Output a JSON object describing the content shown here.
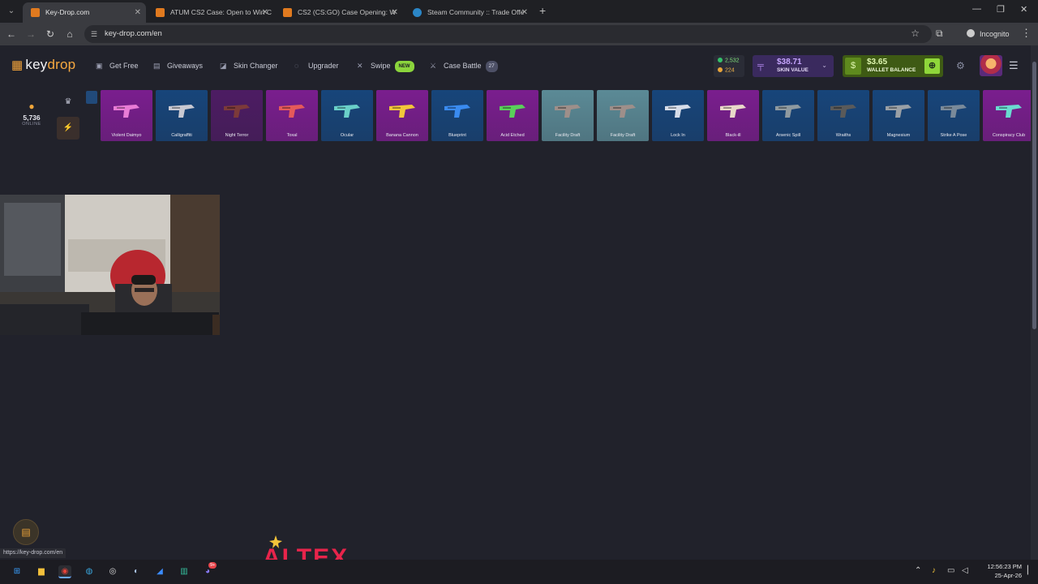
{
  "browser": {
    "tabs": [
      {
        "title": "Key-Drop.com",
        "active": true,
        "favicon": "key-drop-favicon"
      },
      {
        "title": "ATUM CS2 Case: Open to Win C",
        "active": false,
        "favicon": "key-drop-favicon"
      },
      {
        "title": "CS2 (CS:GO) Case Opening: W",
        "active": false,
        "favicon": "key-drop-favicon"
      },
      {
        "title": "Steam Community :: Trade Offe",
        "active": false,
        "favicon": "steam-favicon"
      }
    ],
    "url": "key-drop.com/en",
    "profile_label": "Incognito",
    "status_url": "https://key-drop.com/en"
  },
  "site": {
    "logo": {
      "key": "key",
      "drop": "drop"
    },
    "nav": [
      {
        "label": "Get Free",
        "icon": "gift-icon"
      },
      {
        "label": "Giveaways",
        "icon": "giveaway-icon"
      },
      {
        "label": "Skin Changer",
        "icon": "skin-changer-icon"
      },
      {
        "label": "Upgrader",
        "icon": "upgrader-icon"
      },
      {
        "label": "Swipe",
        "icon": "swipe-icon",
        "badge": "NEW"
      },
      {
        "label": "Case Battle",
        "icon": "swords-icon",
        "badge": "27"
      }
    ],
    "currency": {
      "gems": "2,532",
      "coins": "224"
    },
    "skin_value": {
      "amount": "$38.71",
      "label": "SKIN VALUE"
    },
    "wallet": {
      "amount": "$3.65",
      "label": "WALLET BALANCE"
    },
    "online": {
      "count": "5,736",
      "label": "ONLINE"
    }
  },
  "drops": [
    {
      "name": "Violent Daimyo",
      "bg": "#7a1e8e"
    },
    {
      "name": "Calligraffiti",
      "bg": "#17457a"
    },
    {
      "name": "Night Terror",
      "bg": "#4d1c63"
    },
    {
      "name": "Toxal",
      "bg": "#7a1e8e"
    },
    {
      "name": "Ocular",
      "bg": "#17457a"
    },
    {
      "name": "Banana Cannon",
      "bg": "#7a1e8e"
    },
    {
      "name": "Blueprint",
      "bg": "#17457a"
    },
    {
      "name": "Acid Etched",
      "bg": "#7a1e8e"
    },
    {
      "name": "Facility Draft",
      "bg": "#5b8a96"
    },
    {
      "name": "Facility Draft",
      "bg": "#5b8a96"
    },
    {
      "name": "Lock In",
      "bg": "#17457a"
    },
    {
      "name": "Black-ill",
      "bg": "#7a1e8e"
    },
    {
      "name": "Arsenic Spill",
      "bg": "#17457a"
    },
    {
      "name": "Wraiths",
      "bg": "#17457a"
    },
    {
      "name": "Magnesium",
      "bg": "#17457a"
    },
    {
      "name": "Strike A Pose",
      "bg": "#17457a"
    },
    {
      "name": "Conspiracy Club",
      "bg": "#7a1e8e"
    }
  ],
  "sponsor": {
    "text": "ALTEX"
  },
  "taskbar": {
    "time": "12:56:23 PM",
    "date": "25-Apr-26",
    "notification_count": "9+"
  }
}
